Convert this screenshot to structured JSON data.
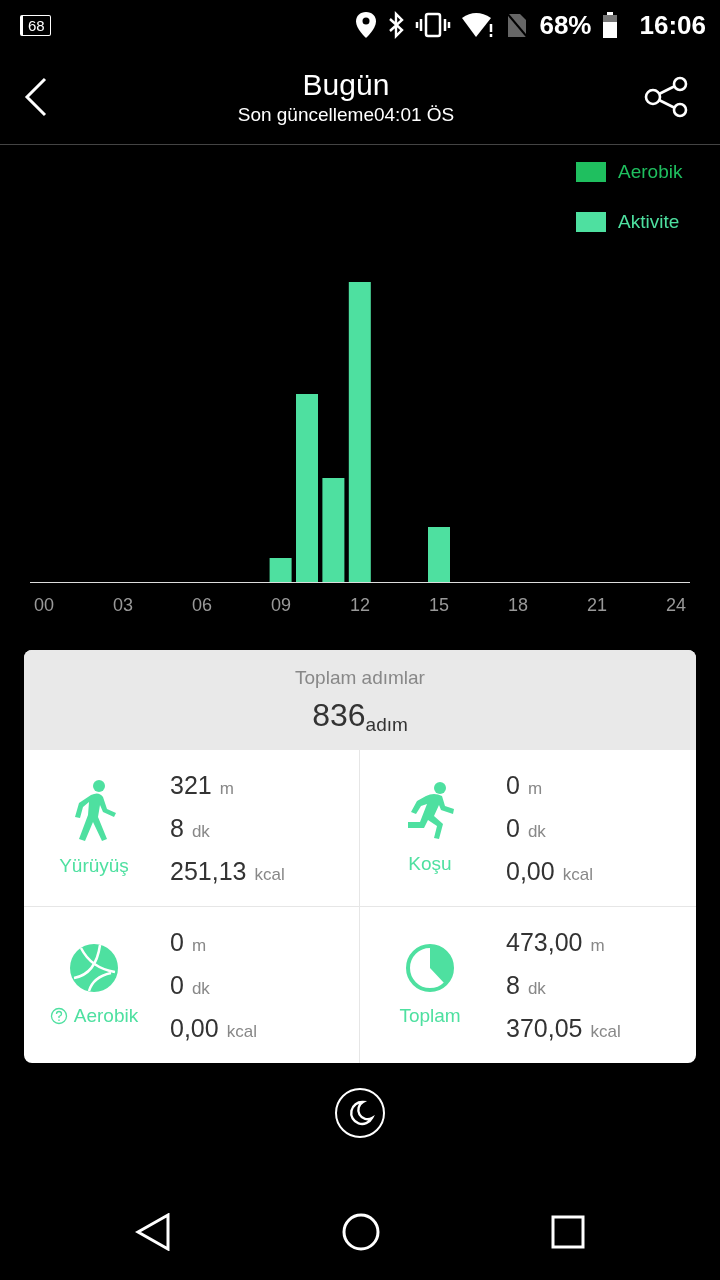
{
  "status_bar": {
    "notification": "68",
    "battery": "68%",
    "time": "16:06"
  },
  "header": {
    "title": "Bugün",
    "subtitle": "Son güncelleme04:01 ÖS"
  },
  "chart": {
    "legend": [
      {
        "label": "Aerobik",
        "color": "#1fbf5f"
      },
      {
        "label": "Aktivite",
        "color": "#4ee0a0"
      }
    ],
    "x_labels": [
      "00",
      "03",
      "06",
      "09",
      "12",
      "15",
      "18",
      "21",
      "24"
    ]
  },
  "summary": {
    "label": "Toplam adımlar",
    "value": "836",
    "unit": "adım"
  },
  "stats": [
    {
      "kind": "walk",
      "label": "Yürüyüş",
      "lines": [
        {
          "value": "321",
          "unit": "m"
        },
        {
          "value": "8",
          "unit": "dk"
        },
        {
          "value": "251,13",
          "unit": "kcal"
        }
      ]
    },
    {
      "kind": "run",
      "label": "Koşu",
      "lines": [
        {
          "value": "0",
          "unit": "m"
        },
        {
          "value": "0",
          "unit": "dk"
        },
        {
          "value": "0,00",
          "unit": "kcal"
        }
      ]
    },
    {
      "kind": "aerobic",
      "label": "Aerobik",
      "lines": [
        {
          "value": "0",
          "unit": "m"
        },
        {
          "value": "0",
          "unit": "dk"
        },
        {
          "value": "0,00",
          "unit": "kcal"
        }
      ]
    },
    {
      "kind": "total",
      "label": "Toplam",
      "lines": [
        {
          "value": "473,00",
          "unit": "m"
        },
        {
          "value": "8",
          "unit": "dk"
        },
        {
          "value": "370,05",
          "unit": "kcal"
        }
      ]
    }
  ]
}
